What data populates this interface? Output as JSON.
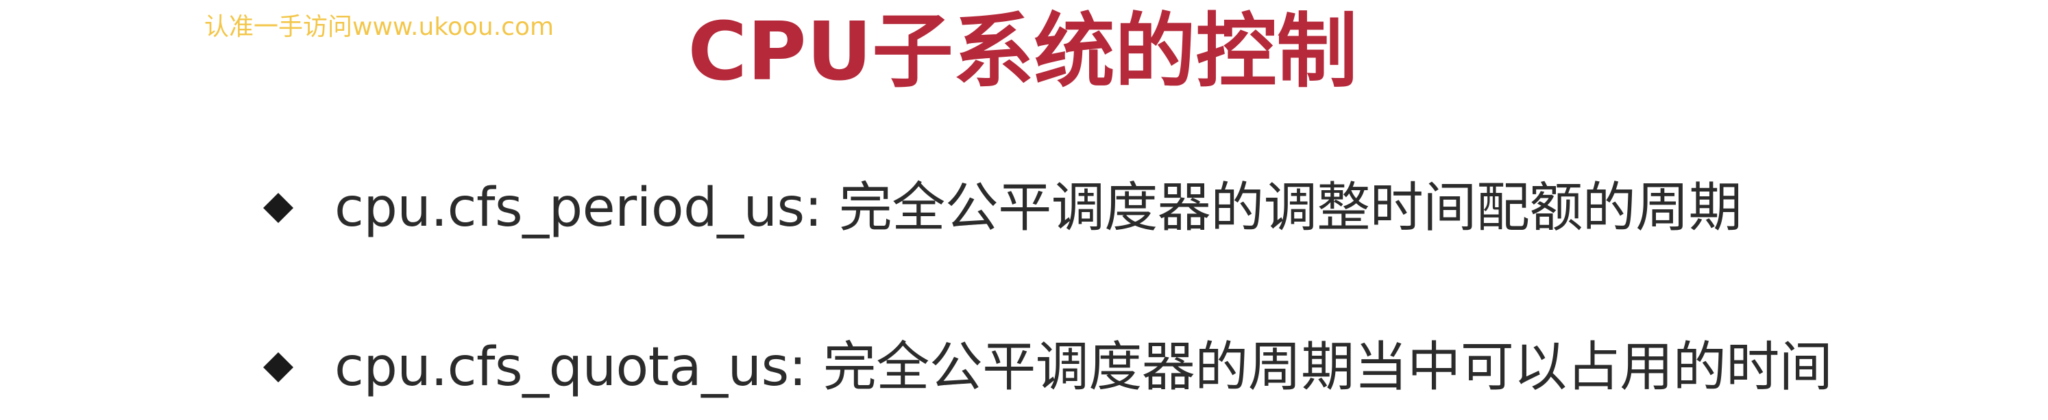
{
  "watermark": "认准一手访问www.ukoou.com",
  "title": "CPU子系统的控制",
  "bullets": [
    {
      "icon": "diamond-bullet-icon",
      "text": "cpu.cfs_period_us: 完全公平调度器的调整时间配额的周期"
    },
    {
      "icon": "diamond-bullet-icon",
      "text": "cpu.cfs_quota_us: 完全公平调度器的周期当中可以占用的时间"
    }
  ],
  "colors": {
    "title": "#b5293a",
    "body_text": "#2b2b2b",
    "watermark": "#f3c64a",
    "bullet": "#1a1a1a"
  }
}
